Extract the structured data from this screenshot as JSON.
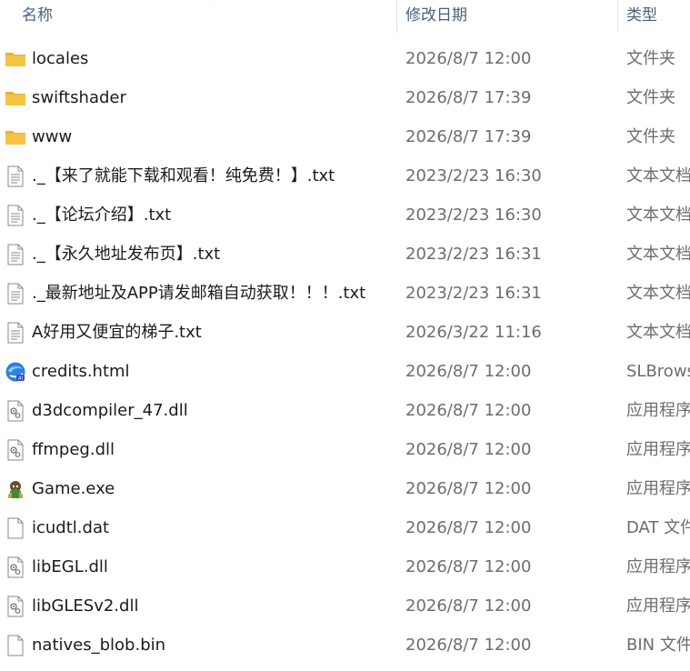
{
  "columns": {
    "name": "名称",
    "date": "修改日期",
    "type": "类型"
  },
  "colors": {
    "header_text": "#4c607a",
    "name_text": "#1b1b1b",
    "meta_text": "#6d6d6d",
    "folder": "#f6c342"
  },
  "files": [
    {
      "name": "locales",
      "date": "2026/8/7 12:00",
      "type": "文件夹",
      "icon": "folder-icon"
    },
    {
      "name": "swiftshader",
      "date": "2026/8/7 17:39",
      "type": "文件夹",
      "icon": "folder-icon"
    },
    {
      "name": "www",
      "date": "2026/8/7 17:39",
      "type": "文件夹",
      "icon": "folder-icon"
    },
    {
      "name": "._【来了就能下载和观看！纯免费！】.txt",
      "date": "2023/2/23 16:30",
      "type": "文本文档",
      "icon": "text-file-icon"
    },
    {
      "name": "._【论坛介绍】.txt",
      "date": "2023/2/23 16:30",
      "type": "文本文档",
      "icon": "text-file-icon"
    },
    {
      "name": "._【永久地址发布页】.txt",
      "date": "2023/2/23 16:31",
      "type": "文本文档",
      "icon": "text-file-icon"
    },
    {
      "name": "._最新地址及APP请发邮箱自动获取！！！.txt",
      "date": "2023/2/23 16:31",
      "type": "文本文档",
      "icon": "text-file-icon"
    },
    {
      "name": "A好用又便宜的梯子.txt",
      "date": "2026/3/22 11:16",
      "type": "文本文档",
      "icon": "text-file-icon"
    },
    {
      "name": "credits.html",
      "date": "2026/8/7 12:00",
      "type": "SLBrowser",
      "icon": "browser-icon"
    },
    {
      "name": "d3dcompiler_47.dll",
      "date": "2026/8/7 12:00",
      "type": "应用程序扩展",
      "icon": "dll-file-icon"
    },
    {
      "name": "ffmpeg.dll",
      "date": "2026/8/7 12:00",
      "type": "应用程序扩展",
      "icon": "dll-file-icon"
    },
    {
      "name": "Game.exe",
      "date": "2026/8/7 12:00",
      "type": "应用程序",
      "icon": "game-exe-icon"
    },
    {
      "name": "icudtl.dat",
      "date": "2026/8/7 12:00",
      "type": "DAT 文件",
      "icon": "blank-file-icon"
    },
    {
      "name": "libEGL.dll",
      "date": "2026/8/7 12:00",
      "type": "应用程序扩展",
      "icon": "dll-file-icon"
    },
    {
      "name": "libGLESv2.dll",
      "date": "2026/8/7 12:00",
      "type": "应用程序扩展",
      "icon": "dll-file-icon"
    },
    {
      "name": "natives_blob.bin",
      "date": "2026/8/7 12:00",
      "type": "BIN 文件",
      "icon": "blank-file-icon"
    }
  ]
}
